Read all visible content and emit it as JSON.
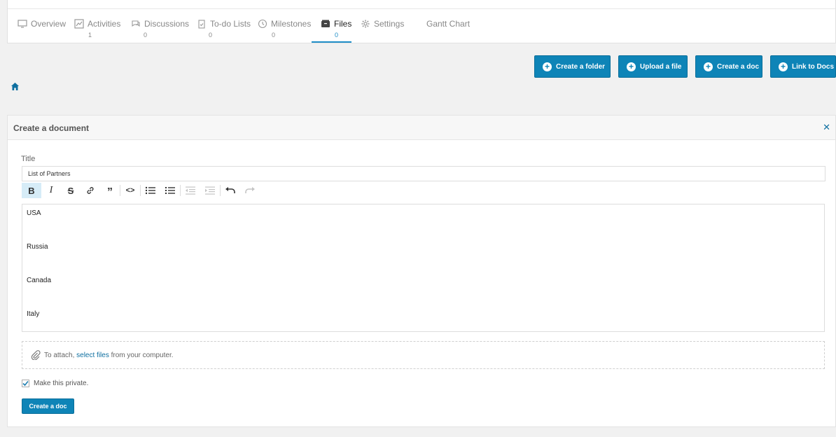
{
  "tabs": [
    {
      "name": "overview",
      "label": "Overview",
      "count": "",
      "icon": "overview-icon"
    },
    {
      "name": "activities",
      "label": "Activities",
      "count": "1",
      "icon": "activity-icon"
    },
    {
      "name": "discussions",
      "label": "Discussions",
      "count": "0",
      "icon": "chat-icon"
    },
    {
      "name": "todo-lists",
      "label": "To-do Lists",
      "count": "0",
      "icon": "clipboard-icon"
    },
    {
      "name": "milestones",
      "label": "Milestones",
      "count": "0",
      "icon": "clock-icon"
    },
    {
      "name": "files",
      "label": "Files",
      "count": "0",
      "icon": "files-icon",
      "active": true
    },
    {
      "name": "settings",
      "label": "Settings",
      "count": "",
      "icon": "gear-icon"
    },
    {
      "name": "gantt-chart",
      "label": "Gantt Chart",
      "count": ""
    }
  ],
  "actions": {
    "create_folder": "Create a folder",
    "upload_file": "Upload a file",
    "create_doc": "Create a doc",
    "link_docs": "Link to Docs"
  },
  "panel": {
    "title": "Create a document",
    "close_symbol": "✕",
    "title_label": "Title",
    "title_value": "List of Partners",
    "editor_lines": [
      "USA",
      "Russia",
      "Canada",
      "Italy"
    ],
    "attach_prefix": "To attach, ",
    "attach_link": "select files",
    "attach_suffix": " from your computer.",
    "private_label": "Make this private.",
    "private_checked": true,
    "submit_label": "Create a doc"
  },
  "colors": {
    "primary": "#0e84b7",
    "active_tab_underline": "#1f8ec7",
    "link": "#0e6fa0"
  }
}
